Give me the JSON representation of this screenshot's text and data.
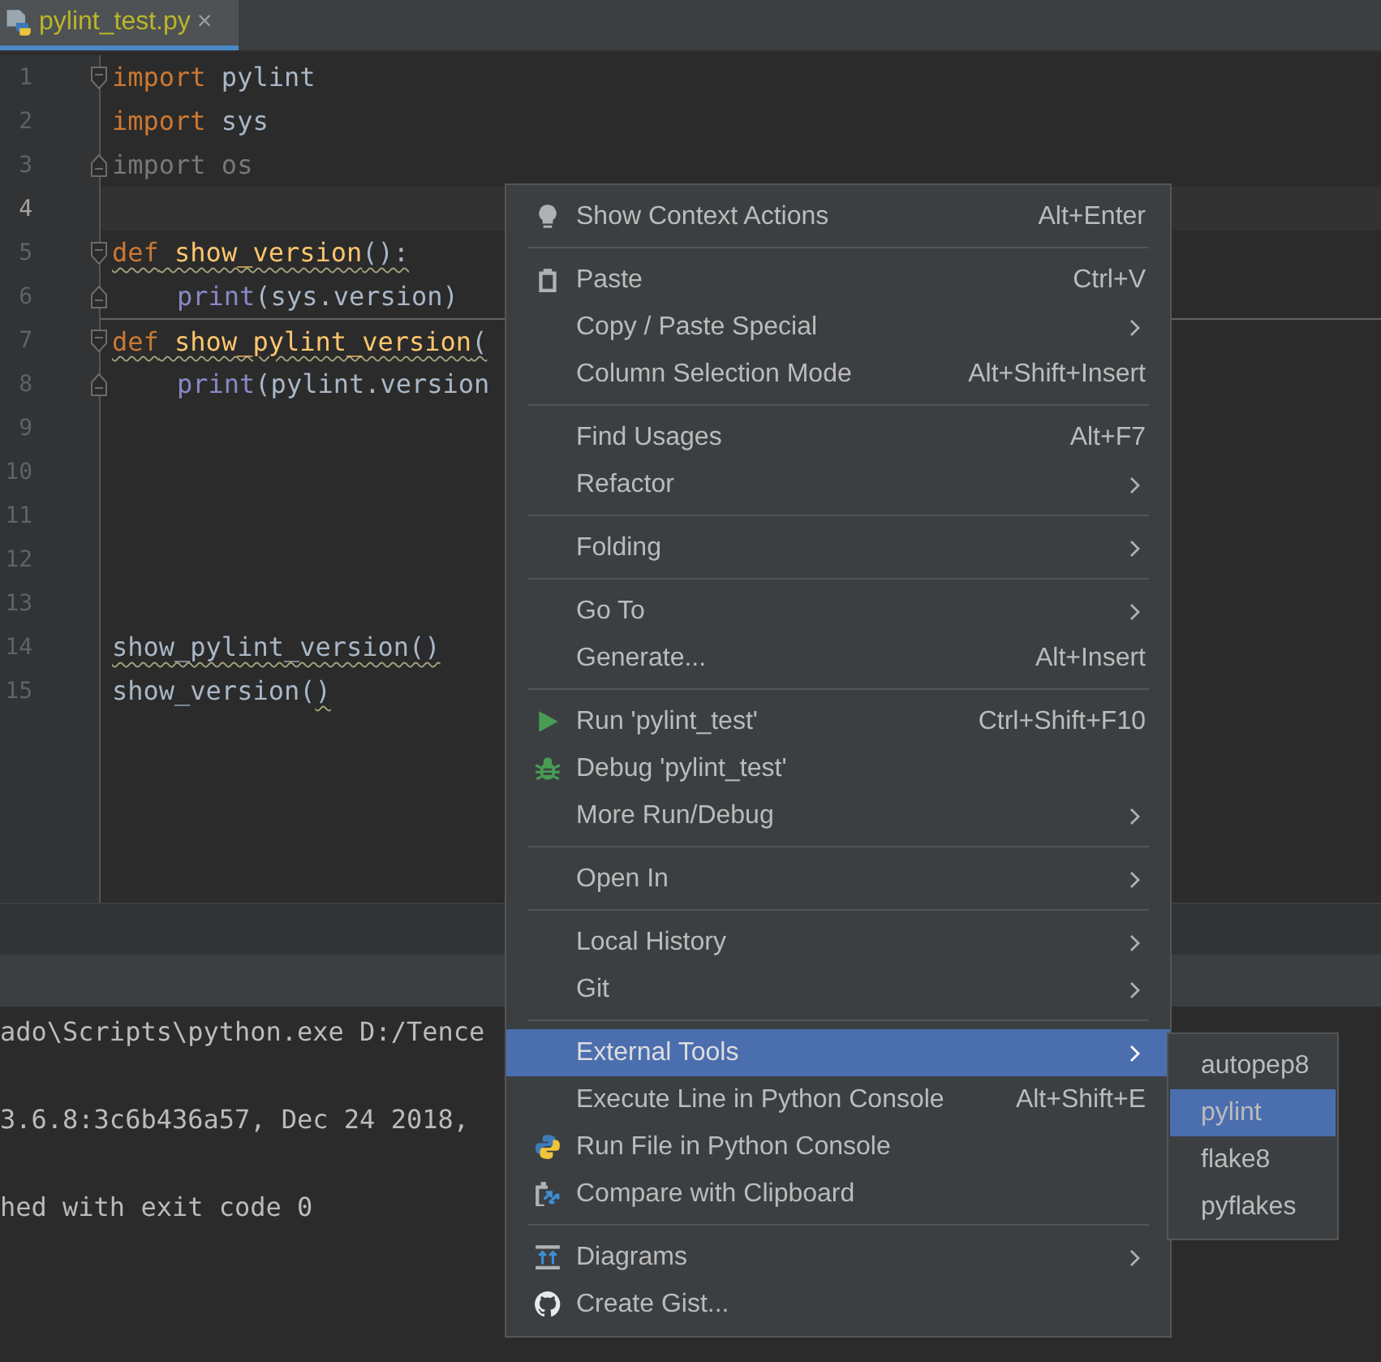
{
  "tabs": [
    {
      "label": "pylint_test.py",
      "selected": true,
      "close": "×"
    }
  ],
  "code_lines": [
    {
      "number": "1",
      "current": false,
      "fold_start": true,
      "fold_end": false,
      "indent": false,
      "separator_above": false,
      "tokens": [
        {
          "text": "import",
          "kind": "keyword",
          "warning": false
        },
        {
          "text": " pylint",
          "kind": "plain",
          "warning": false
        }
      ]
    },
    {
      "number": "2",
      "current": false,
      "fold_start": false,
      "fold_end": false,
      "indent": false,
      "separator_above": false,
      "tokens": [
        {
          "text": "import",
          "kind": "keyword",
          "warning": false
        },
        {
          "text": " sys",
          "kind": "plain",
          "warning": false
        }
      ]
    },
    {
      "number": "3",
      "current": false,
      "fold_start": false,
      "fold_end": true,
      "indent": false,
      "separator_above": false,
      "tokens": [
        {
          "text": "import os",
          "kind": "unused",
          "warning": false
        }
      ]
    },
    {
      "number": "4",
      "current": true,
      "fold_start": false,
      "fold_end": false,
      "separator_above": false
    },
    {
      "number": "5",
      "current": false,
      "fold_start": true,
      "fold_end": false,
      "indent": false,
      "separator_above": false,
      "tokens": [
        {
          "text": "def",
          "kind": "keyword",
          "warning": true
        },
        {
          "text": " show_version",
          "kind": "function",
          "warning": true
        },
        {
          "text": "():",
          "kind": "plain",
          "warning": true
        }
      ]
    },
    {
      "number": "6",
      "current": false,
      "fold_start": false,
      "fold_end": true,
      "indent": true,
      "separator_above": false,
      "tokens": [
        {
          "text": "print",
          "kind": "builtin",
          "warning": false
        },
        {
          "text": "(sys.version)",
          "kind": "plain",
          "warning": false
        }
      ]
    },
    {
      "number": "7",
      "current": false,
      "fold_start": true,
      "fold_end": false,
      "indent": false,
      "separator_above": true,
      "tokens": [
        {
          "text": "def",
          "kind": "keyword",
          "warning": true
        },
        {
          "text": " show_pylint_version",
          "kind": "function",
          "warning": true
        },
        {
          "text": "(",
          "kind": "plain",
          "warning": true
        }
      ]
    },
    {
      "number": "8",
      "current": false,
      "fold_start": false,
      "fold_end": true,
      "indent": true,
      "separator_above": false,
      "tokens": [
        {
          "text": "print",
          "kind": "builtin",
          "warning": false
        },
        {
          "text": "(pylint.version",
          "kind": "plain",
          "warning": false
        }
      ]
    },
    {
      "number": "9",
      "current": false,
      "fold_start": false,
      "fold_end": false,
      "separator_above": false
    },
    {
      "number": "10",
      "current": false,
      "fold_start": false,
      "fold_end": false,
      "separator_above": false
    },
    {
      "number": "11",
      "current": false,
      "fold_start": false,
      "fold_end": false,
      "separator_above": false
    },
    {
      "number": "12",
      "current": false,
      "fold_start": false,
      "fold_end": false,
      "separator_above": false
    },
    {
      "number": "13",
      "current": false,
      "fold_start": false,
      "fold_end": false,
      "separator_above": false
    },
    {
      "number": "14",
      "current": false,
      "fold_start": false,
      "fold_end": false,
      "indent": false,
      "separator_above": false,
      "tokens": [
        {
          "text": "show_pylint_version()",
          "kind": "plain",
          "warning": true
        }
      ]
    },
    {
      "number": "15",
      "current": false,
      "fold_start": false,
      "fold_end": false,
      "indent": false,
      "separator_above": false,
      "tokens": [
        {
          "text": "show_version(",
          "kind": "plain",
          "warning": false
        },
        {
          "text": ")",
          "kind": "plain",
          "warning": true
        }
      ]
    }
  ],
  "console_lines": [
    "ado\\Scripts\\python.exe D:/Tence",
    "3.6.8:3c6b436a57, Dec 24 2018,",
    "hed with exit code 0"
  ],
  "menu": {
    "groups": [
      {
        "items": [
          {
            "kind": "bulb",
            "label": "Show Context Actions",
            "shortcut": "Alt+Enter",
            "submenu": false,
            "selected": false
          }
        ]
      },
      {
        "items": [
          {
            "kind": "clipboard",
            "label": "Paste",
            "shortcut": "Ctrl+V",
            "submenu": false,
            "selected": false
          },
          {
            "kind": "plain",
            "label": "Copy / Paste Special",
            "submenu": true,
            "selected": false
          },
          {
            "kind": "plain",
            "label": "Column Selection Mode",
            "shortcut": "Alt+Shift+Insert",
            "submenu": false,
            "selected": false
          }
        ]
      },
      {
        "items": [
          {
            "kind": "plain",
            "label": "Find Usages",
            "shortcut": "Alt+F7",
            "submenu": false,
            "selected": false
          },
          {
            "kind": "plain",
            "label": "Refactor",
            "submenu": true,
            "selected": false
          }
        ]
      },
      {
        "items": [
          {
            "kind": "plain",
            "label": "Folding",
            "submenu": true,
            "selected": false
          }
        ]
      },
      {
        "items": [
          {
            "kind": "plain",
            "label": "Go To",
            "submenu": true,
            "selected": false
          },
          {
            "kind": "plain",
            "label": "Generate...",
            "shortcut": "Alt+Insert",
            "submenu": false,
            "selected": false
          }
        ]
      },
      {
        "items": [
          {
            "kind": "run",
            "label": "Run 'pylint_test'",
            "shortcut": "Ctrl+Shift+F10",
            "submenu": false,
            "selected": false
          },
          {
            "kind": "debug",
            "label": "Debug 'pylint_test'",
            "submenu": false,
            "selected": false
          },
          {
            "kind": "plain",
            "label": "More Run/Debug",
            "submenu": true,
            "selected": false
          }
        ]
      },
      {
        "items": [
          {
            "kind": "plain",
            "label": "Open In",
            "submenu": true,
            "selected": false
          }
        ]
      },
      {
        "items": [
          {
            "kind": "plain",
            "label": "Local History",
            "submenu": true,
            "selected": false
          },
          {
            "kind": "plain",
            "label": "Git",
            "submenu": true,
            "selected": false
          }
        ]
      },
      {
        "items": [
          {
            "kind": "plain",
            "label": "External Tools",
            "submenu": true,
            "selected": true
          },
          {
            "kind": "plain",
            "label": "Execute Line in Python Console",
            "shortcut": "Alt+Shift+E",
            "submenu": false,
            "selected": false
          },
          {
            "kind": "python",
            "label": "Run File in Python Console",
            "submenu": false,
            "selected": false
          },
          {
            "kind": "compare",
            "label": "Compare with Clipboard",
            "submenu": false,
            "selected": false
          }
        ]
      },
      {
        "items": [
          {
            "kind": "diagrams",
            "label": "Diagrams",
            "submenu": true,
            "selected": false
          },
          {
            "kind": "github",
            "label": "Create Gist...",
            "submenu": false,
            "selected": false
          }
        ]
      }
    ]
  },
  "submenu": {
    "items": [
      {
        "label": "autopep8",
        "selected": false
      },
      {
        "label": "pylint",
        "selected": true
      },
      {
        "label": "flake8",
        "selected": false
      },
      {
        "label": "pyflakes",
        "selected": false
      }
    ]
  }
}
